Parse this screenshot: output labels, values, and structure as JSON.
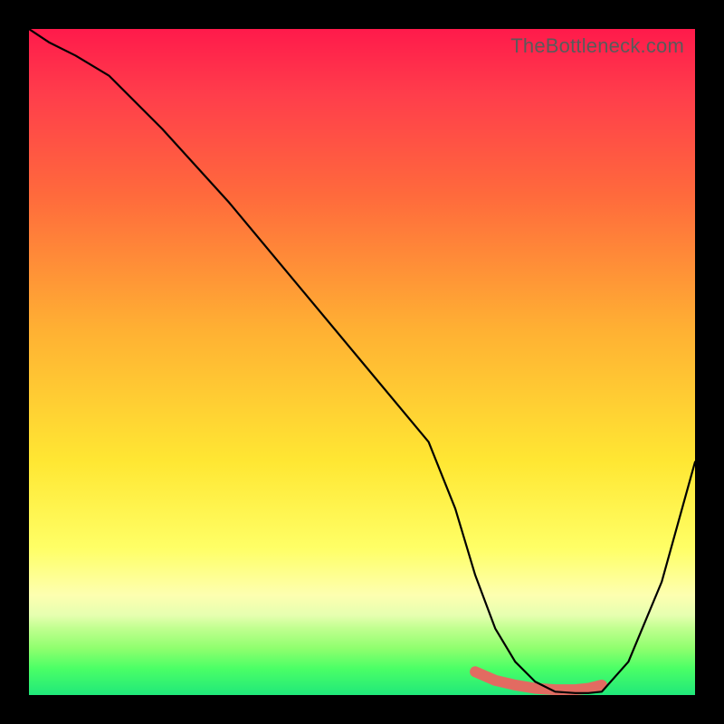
{
  "watermark": "TheBottleneck.com",
  "chart_data": {
    "type": "line",
    "title": "",
    "xlabel": "",
    "ylabel": "",
    "xlim": [
      0,
      100
    ],
    "ylim": [
      0,
      100
    ],
    "axes_visible": false,
    "grid": false,
    "background_gradient": {
      "top": "#ff1a4b",
      "mid": "#ffe733",
      "bottom": "#20e87a"
    },
    "series": [
      {
        "name": "bottleneck-curve",
        "color": "#000000",
        "x": [
          0,
          3,
          7,
          12,
          20,
          30,
          40,
          50,
          60,
          64,
          67,
          70,
          73,
          76,
          79,
          82,
          84,
          86,
          90,
          95,
          100
        ],
        "values": [
          100,
          98,
          96,
          93,
          85,
          74,
          62,
          50,
          38,
          28,
          18,
          10,
          5,
          2,
          0.5,
          0.3,
          0.3,
          0.5,
          5,
          17,
          35
        ]
      }
    ],
    "highlight": {
      "name": "optimal-range",
      "color": "#e26b61",
      "x": [
        67,
        70,
        73,
        76,
        79,
        82,
        84,
        86
      ],
      "values": [
        3.5,
        2.2,
        1.5,
        1.0,
        0.8,
        0.8,
        1.0,
        1.5
      ]
    }
  }
}
